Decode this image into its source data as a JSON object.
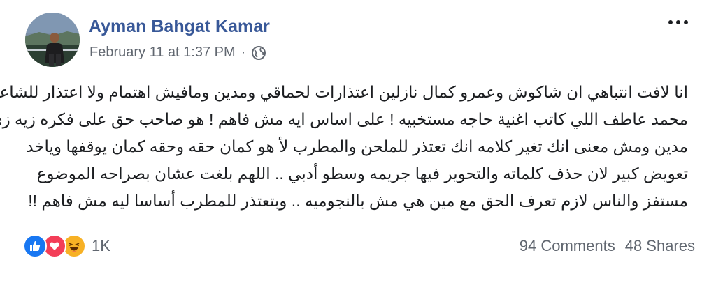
{
  "post": {
    "author": "Ayman Bahgat Kamar",
    "timestamp": "February 11 at 1:37 PM",
    "separator": "·",
    "privacy_icon": "globe-icon",
    "more_icon": "more-options-icon",
    "lines": [
      "انا لافت انتباهي ان شاكوش وعمرو كمال نازلين اعتذارات لحماقي ومدين ومافيش اهتمام ولا اعتذار للشاعر",
      "محمد عاطف اللي كاتب اغنية حاجه مستخبيه ! على اساس ايه مش فاهم ! هو صاحب حق على فكره زيه زي",
      "مدين ومش معنى انك تغير كلامه انك تعتذر للملحن والمطرب لأ هو كمان حقه وحقه كمان يوقفها وياخد",
      "تعويض كبير لان حذف كلماته والتحوير فيها جريمه وسطو أدبي .. اللهم بلغت عشان بصراحه الموضوع",
      "مستفز والناس لازم تعرف الحق مع مين هي مش بالنجوميه .. وبتعتذر للمطرب أساسا ليه مش فاهم !!"
    ]
  },
  "footer": {
    "reaction_icons": [
      "like-icon",
      "love-icon",
      "haha-icon"
    ],
    "reaction_count": "1K",
    "comments": "94 Comments",
    "shares": "48 Shares"
  },
  "colors": {
    "author": "#385898",
    "meta": "#616770",
    "like": "#1877f2",
    "love": "#f33e58",
    "haha": "#f7b125"
  }
}
